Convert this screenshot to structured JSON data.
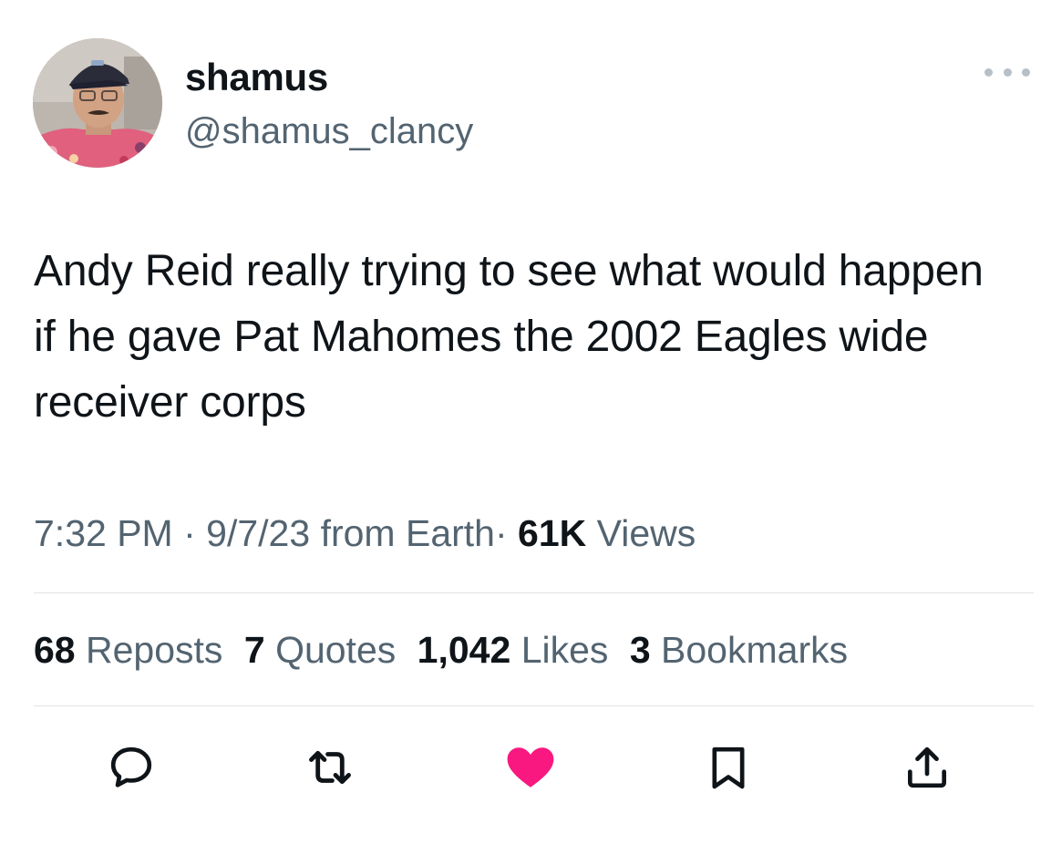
{
  "tweet": {
    "display_name": "shamus",
    "handle": "@shamus_clancy",
    "text": "Andy Reid really trying to see what would happen if he gave Pat Mahomes the 2002 Eagles wide receiver corps",
    "time": "7:32 PM",
    "date": "9/7/23",
    "source": "from Earth",
    "views_count": "61K",
    "views_label": "Views",
    "separator": "·"
  },
  "stats": [
    {
      "count": "68",
      "label": "Reposts"
    },
    {
      "count": "7",
      "label": "Quotes"
    },
    {
      "count": "1,042",
      "label": "Likes"
    },
    {
      "count": "3",
      "label": "Bookmarks"
    }
  ],
  "actions": {
    "reply_icon": "speech-bubble-icon",
    "repost_icon": "repost-arrows-icon",
    "like_icon": "heart-icon",
    "bookmark_icon": "bookmark-icon",
    "share_icon": "share-upload-icon"
  },
  "colors": {
    "text": "#0f1419",
    "secondary": "#536471",
    "like_active": "#f91880",
    "divider": "#dfe3e6"
  }
}
